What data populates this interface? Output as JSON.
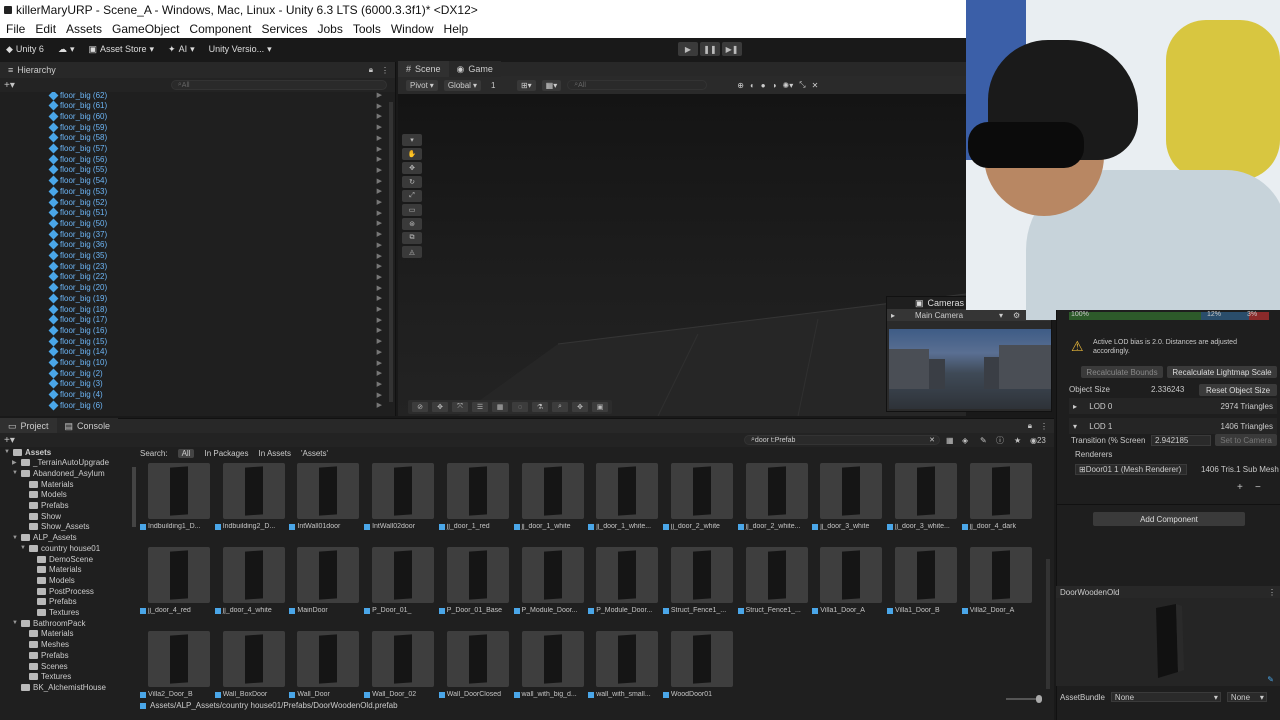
{
  "window": {
    "title": "killerMaryURP - Scene_A - Windows, Mac, Linux - Unity 6.3 LTS (6000.3.3f1)* <DX12>"
  },
  "menu": [
    "File",
    "Edit",
    "Assets",
    "GameObject",
    "Component",
    "Services",
    "Jobs",
    "Tools",
    "Window",
    "Help"
  ],
  "toolbar": {
    "unity_label": "Unity 6",
    "asset_store": "Asset Store",
    "ai": "AI",
    "version": "Unity Versio..."
  },
  "hierarchy": {
    "tab": "Hierarchy",
    "search_placeholder": "All",
    "items": [
      "floor_big (62)",
      "floor_big (61)",
      "floor_big (60)",
      "floor_big (59)",
      "floor_big (58)",
      "floor_big (57)",
      "floor_big (56)",
      "floor_big (55)",
      "floor_big (54)",
      "floor_big (53)",
      "floor_big (52)",
      "floor_big (51)",
      "floor_big (50)",
      "floor_big (37)",
      "floor_big (36)",
      "floor_big (35)",
      "floor_big (23)",
      "floor_big (22)",
      "floor_big (20)",
      "floor_big (19)",
      "floor_big (18)",
      "floor_big (17)",
      "floor_big (16)",
      "floor_big (15)",
      "floor_big (14)",
      "floor_big (10)",
      "floor_big (2)",
      "floor_big (3)",
      "floor_big (4)",
      "floor_big (6)"
    ]
  },
  "scene": {
    "tabs": [
      "Scene",
      "Game"
    ],
    "pivot": "Pivot",
    "global": "Global",
    "snap_value": "1",
    "search_placeholder": "All"
  },
  "cameras": {
    "title": "Cameras",
    "selected": "Main Camera"
  },
  "inspector": {
    "bar_labels": [
      "100%",
      "12%",
      "3%"
    ],
    "warning": "Active LOD bias is 2.0. Distances are adjusted accordingly.",
    "recalc_bounds": "Recalculate Bounds",
    "recalc_lightmap": "Recalculate Lightmap Scale",
    "object_size_label": "Object Size",
    "object_size_value": "2.336243",
    "reset_object_size": "Reset Object Size",
    "lod0_label": "LOD 0",
    "lod0_tris": "2974 Triangles",
    "lod1_label": "LOD 1",
    "lod1_tris": "1406 Triangles",
    "transition_label": "Transition (% Screen",
    "transition_value": "2.942185",
    "set_to_camera": "Set to Camera",
    "renderers_label": "Renderers",
    "renderer_item": "Door01 1 (Mesh Renderer)",
    "renderer_tris": "1406 Tris.1 Sub Mesh",
    "add_component": "Add Component"
  },
  "project": {
    "tabs": [
      "Project",
      "Console"
    ],
    "search_value": "door t:Prefab",
    "result_count": "23",
    "search_label": "Search:",
    "search_scopes": [
      "All",
      "In Packages",
      "In Assets",
      "'Assets'"
    ],
    "tree": [
      {
        "label": "Assets",
        "level": 0
      },
      {
        "label": "_TerrainAutoUpgrade",
        "level": 1
      },
      {
        "label": "Abandoned_Asylum",
        "level": 1
      },
      {
        "label": "Materials",
        "level": 2
      },
      {
        "label": "Models",
        "level": 2
      },
      {
        "label": "Prefabs",
        "level": 2
      },
      {
        "label": "Show",
        "level": 2
      },
      {
        "label": "Show_Assets",
        "level": 2
      },
      {
        "label": "ALP_Assets",
        "level": 1
      },
      {
        "label": "country house01",
        "level": 2
      },
      {
        "label": "DemoScene",
        "level": 3
      },
      {
        "label": "Materials",
        "level": 3
      },
      {
        "label": "Models",
        "level": 3
      },
      {
        "label": "PostProcess",
        "level": 3
      },
      {
        "label": "Prefabs",
        "level": 3
      },
      {
        "label": "Textures",
        "level": 3
      },
      {
        "label": "BathroomPack",
        "level": 1
      },
      {
        "label": "Materials",
        "level": 2
      },
      {
        "label": "Meshes",
        "level": 2
      },
      {
        "label": "Prefabs",
        "level": 2
      },
      {
        "label": "Scenes",
        "level": 2
      },
      {
        "label": "Textures",
        "level": 2
      },
      {
        "label": "BK_AlchemistHouse",
        "level": 1
      }
    ],
    "assets": [
      "Indbuilding1_D...",
      "Indbuilding2_D...",
      "IntWall01door",
      "IntWall02door",
      "jj_door_1_red",
      "jj_door_1_white",
      "jj_door_1_white...",
      "jj_door_2_white",
      "jj_door_2_white...",
      "jj_door_3_white",
      "jj_door_3_white...",
      "jj_door_4_dark",
      "jj_door_4_red",
      "jj_door_4_white",
      "MainDoor",
      "P_Door_01_",
      "P_Door_01_Base",
      "P_Module_Door...",
      "P_Module_Door...",
      "Struct_Fence1_...",
      "Struct_Fence1_...",
      "Villa1_Door_A",
      "Villa1_Door_B",
      "Villa2_Door_A",
      "Villa2_Door_B",
      "Wall_BoxDoor",
      "Wall_Door",
      "Wall_Door_02",
      "Wall_DoorClosed",
      "wall_with_big_d...",
      "wall_with_small...",
      "WoodDoor01"
    ],
    "path": "Assets/ALP_Assets/country house01/Prefabs/DoorWoodenOld.prefab"
  },
  "preview": {
    "title": "DoorWoodenOld",
    "assetbundle_label": "AssetBundle",
    "assetbundle_value": "None",
    "variant_value": "None"
  }
}
